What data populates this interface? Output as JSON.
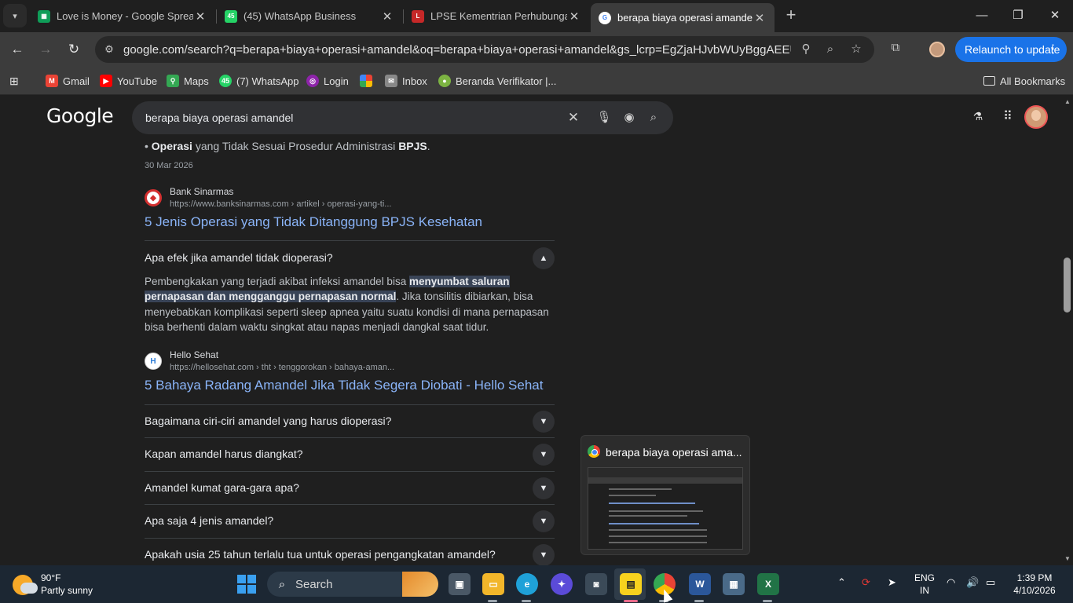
{
  "tabs": [
    {
      "title": "Love is Money - Google Spread",
      "icon": "sheets-icon"
    },
    {
      "title": "(45) WhatsApp Business",
      "icon": "whatsapp-business-icon",
      "badge": "45"
    },
    {
      "title": "LPSE Kementrian Perhubungan",
      "icon": "lpse-icon"
    },
    {
      "title": "berapa biaya operasi amandel -",
      "icon": "google-icon"
    }
  ],
  "toolbar": {
    "url": "google.com/search?q=berapa+biaya+operasi+amandel&oq=berapa+biaya+operasi+amandel&gs_lcrp=EgZjaHJvbWUyBggAEEUYOdIB...",
    "relaunch_label": "Relaunch to update"
  },
  "bookmarks": [
    {
      "label": "Gmail",
      "color": "#ea4335"
    },
    {
      "label": "YouTube",
      "color": "#ff0000"
    },
    {
      "label": "Maps",
      "color": "#34a853"
    },
    {
      "label": "(7) WhatsApp",
      "color": "#25d366",
      "badge": "45"
    },
    {
      "label": "Login",
      "color": "#8e24aa"
    },
    {
      "label": "",
      "color": "#fbbc04"
    },
    {
      "label": "Inbox",
      "color": "#888888"
    },
    {
      "label": "Beranda Verifikator |...",
      "color": "#7cb342"
    }
  ],
  "bookmarks_all": "All Bookmarks",
  "search": {
    "logo": "Google",
    "query": "berapa biaya operasi amandel"
  },
  "results": {
    "bullet_bold1": "Operasi",
    "bullet_mid": " yang Tidak Sesuai Prosedur Administrasi ",
    "bullet_bold2": "BPJS",
    "bullet_end": ".",
    "date": "30 Mar 2026",
    "result1": {
      "site": "Bank Sinarmas",
      "url": "https://www.banksinarmas.com › artikel › operasi-yang-ti...",
      "title": "5 Jenis Operasi yang Tidak Ditanggung BPJS Kesehatan"
    },
    "faq_open": {
      "question": "Apa efek jika amandel tidak dioperasi?",
      "answer_pre": "Pembengkakan yang terjadi akibat infeksi amandel bisa ",
      "answer_hl": "menyumbat saluran pernapasan dan mengganggu pernapasan normal",
      "answer_post": ". Jika tonsilitis dibiarkan, bisa menyebabkan komplikasi seperti sleep apnea yaitu suatu kondisi di mana pernapasan bisa berhenti dalam waktu singkat atau napas menjadi dangkal saat tidur."
    },
    "result2": {
      "site": "Hello Sehat",
      "url": "https://hellosehat.com › tht › tenggorokan › bahaya-aman...",
      "title": "5 Bahaya Radang Amandel Jika Tidak Segera Diobati - Hello Sehat"
    },
    "faqs": [
      "Bagaimana ciri-ciri amandel yang harus dioperasi?",
      "Kapan amandel harus diangkat?",
      "Amandel kumat gara-gara apa?",
      "Apa saja 4 jenis amandel?",
      "Apakah usia 25 tahun terlalu tua untuk operasi pengangkatan amandel?"
    ]
  },
  "preview": {
    "title": "berapa biaya operasi ama..."
  },
  "taskbar": {
    "temp": "90°F",
    "condition": "Partly sunny",
    "search_label": "Search",
    "lang1": "ENG",
    "lang2": "IN",
    "time": "1:39 PM",
    "date": "4/10/2026"
  }
}
